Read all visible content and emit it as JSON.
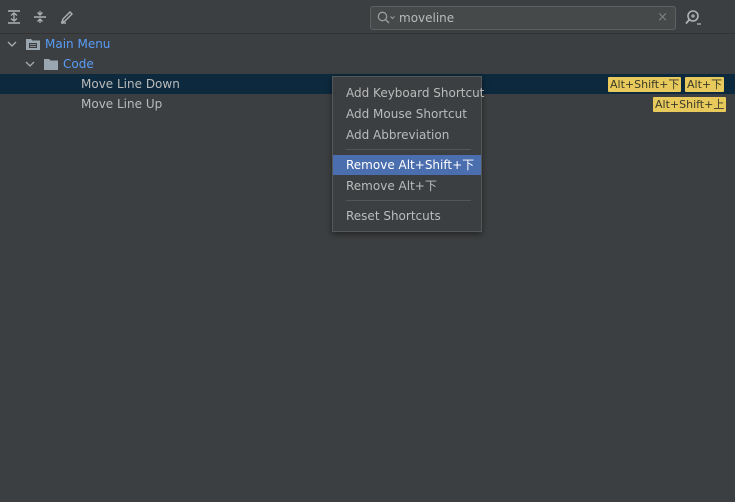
{
  "toolbar": {
    "expand_all_icon": "expand-all-icon",
    "collapse_all_icon": "collapse-all-icon",
    "edit_icon": "edit-shortcut-icon"
  },
  "search": {
    "value": "moveline",
    "clear_glyph": "×"
  },
  "tree": {
    "root": {
      "label": "Main Menu"
    },
    "group": {
      "label": "Code"
    },
    "items": [
      {
        "label": "Move Line Down",
        "shortcuts": [
          "Alt+Shift+下",
          "Alt+下"
        ]
      },
      {
        "label": "Move Line Up",
        "shortcuts": [
          "Alt+Shift+上"
        ]
      }
    ]
  },
  "context_menu": {
    "items": [
      {
        "label": "Add Keyboard Shortcut"
      },
      {
        "label": "Add Mouse Shortcut"
      },
      {
        "label": "Add Abbreviation"
      },
      {
        "label": "Remove Alt+Shift+下"
      },
      {
        "label": "Remove Alt+下"
      },
      {
        "label": "Reset Shortcuts"
      }
    ]
  },
  "colors": {
    "background": "#3c3f41",
    "selection": "#0d293e",
    "menu_highlight": "#4b6eaf",
    "link": "#589df6",
    "shortcut_badge": "#e8c95b"
  }
}
